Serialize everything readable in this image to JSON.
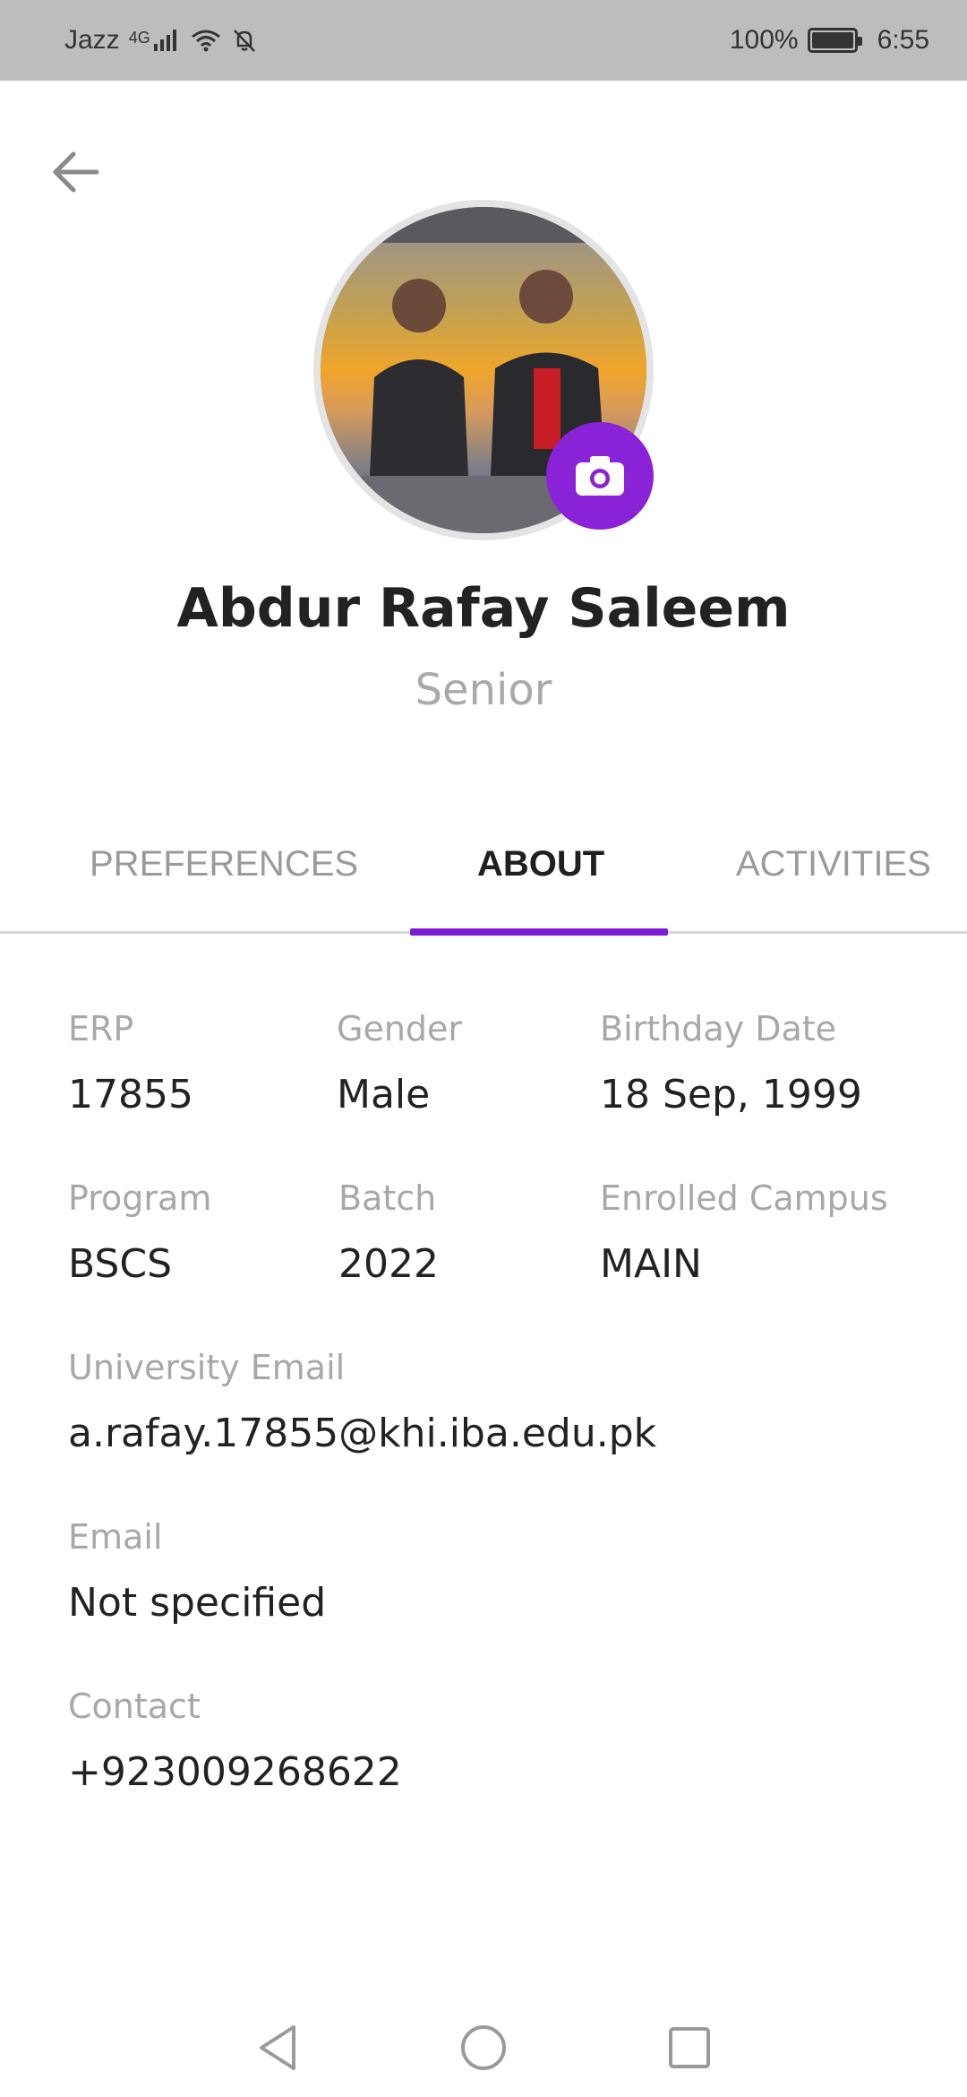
{
  "status_bar": {
    "carrier": "Jazz",
    "network": "4G",
    "battery_percent": "100%",
    "time": "6:55"
  },
  "profile": {
    "name": "Abdur Rafay Saleem",
    "role": "Senior"
  },
  "tabs": [
    {
      "label": "PREFERENCES",
      "active": false
    },
    {
      "label": "ABOUT",
      "active": true
    },
    {
      "label": "ACTIVITIES",
      "active": false
    }
  ],
  "about": {
    "erp": {
      "label": "ERP",
      "value": "17855"
    },
    "gender": {
      "label": "Gender",
      "value": "Male"
    },
    "birthday": {
      "label": "Birthday Date",
      "value": "18 Sep, 1999"
    },
    "program": {
      "label": "Program",
      "value": "BSCS"
    },
    "batch": {
      "label": "Batch",
      "value": "2022"
    },
    "campus": {
      "label": "Enrolled Campus",
      "value": "MAIN"
    },
    "university_email": {
      "label": "University Email",
      "value": "a.rafay.17855@khi.iba.edu.pk"
    },
    "email": {
      "label": "Email",
      "value": "Not specified"
    },
    "contact": {
      "label": "Contact",
      "value": "+923009268622"
    }
  },
  "icons": {
    "back": "arrow-left-icon",
    "camera": "camera-icon",
    "nav_back": "triangle-back-icon",
    "nav_home": "circle-home-icon",
    "nav_recents": "square-recents-icon"
  },
  "colors": {
    "accent": "#7c1ad4",
    "camera_button": "#8a22d8",
    "status_bar_bg": "#bdbdbd",
    "label_gray": "#a8a8a8"
  }
}
